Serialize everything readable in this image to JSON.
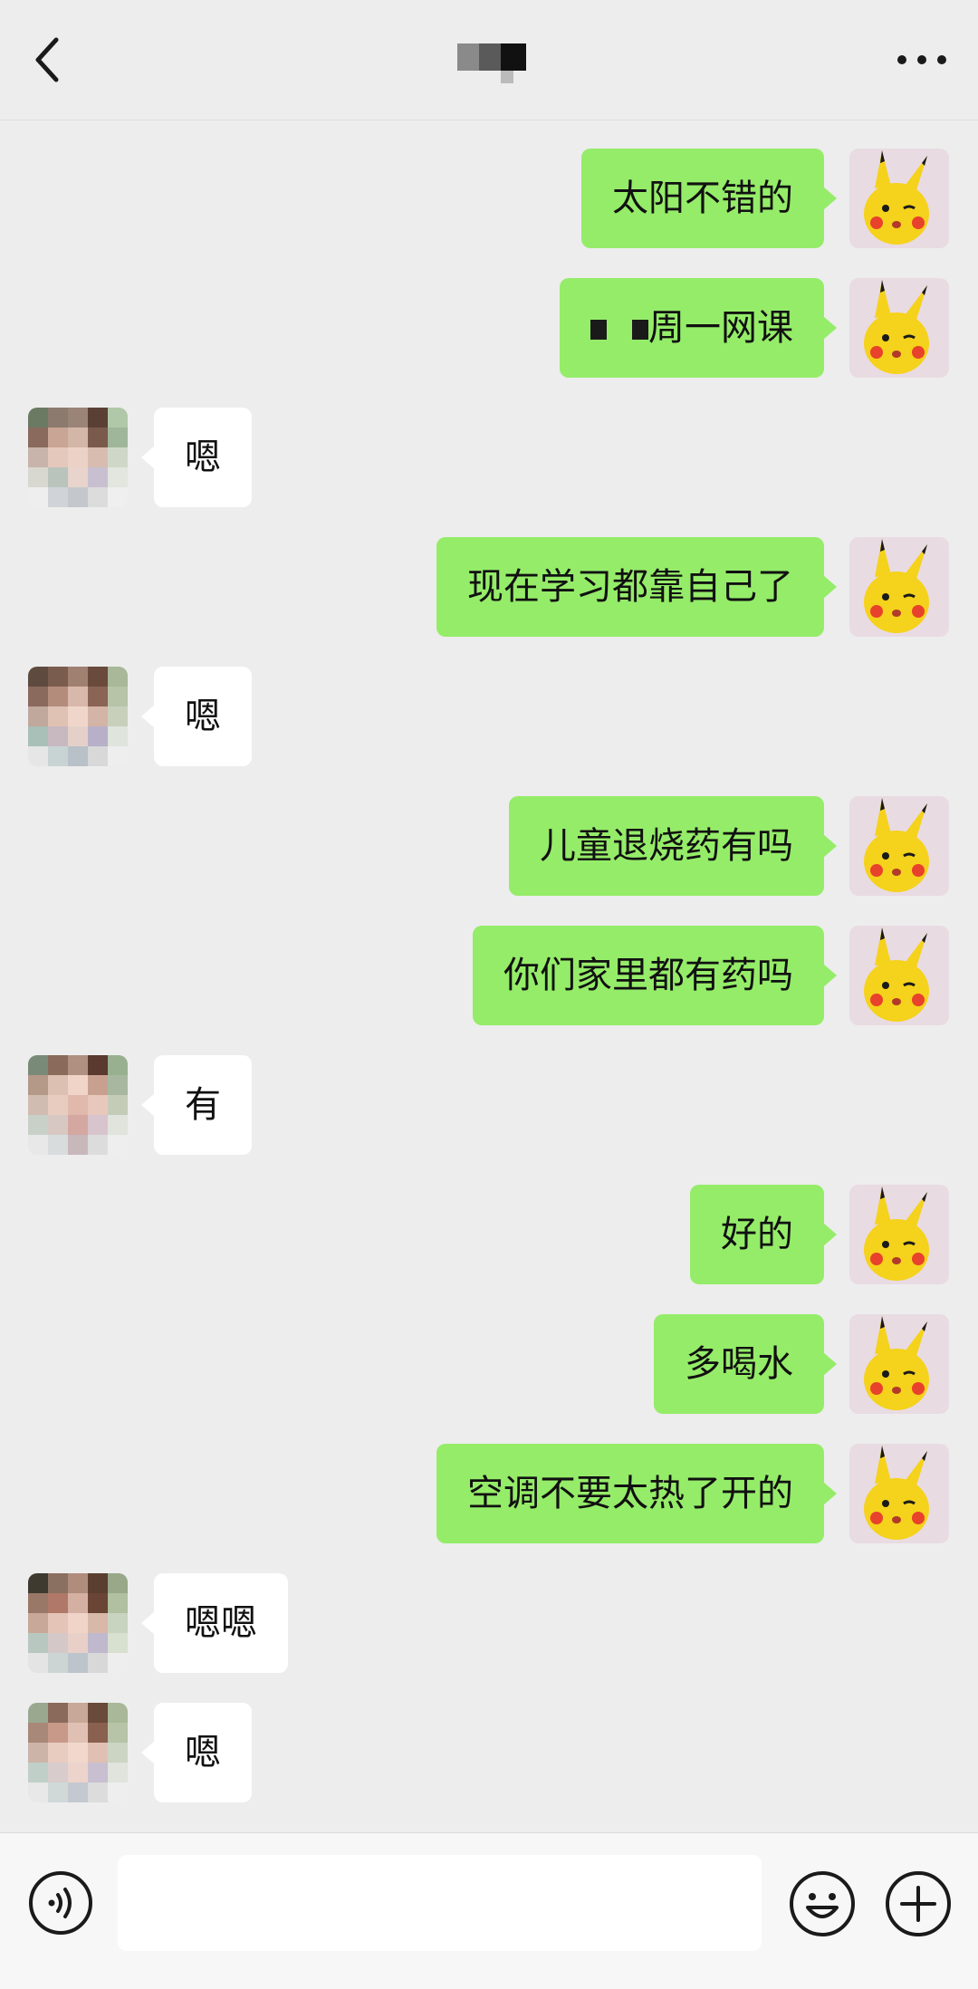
{
  "header": {
    "title": "",
    "back_icon": "chevron-left-icon",
    "more_icon": "more-horizontal-icon"
  },
  "colors": {
    "background": "#ededed",
    "sent_bubble": "#95ec69",
    "received_bubble": "#ffffff",
    "avatar_sent": "#f5d21b",
    "avatar_received": "#c9b3ad"
  },
  "messages": [
    {
      "side": "sent",
      "text": "太阳不错的"
    },
    {
      "side": "sent",
      "text": "周一网课",
      "redacted_prefix": true
    },
    {
      "side": "received",
      "text": "嗯"
    },
    {
      "side": "sent",
      "text": "现在学习都靠自己了"
    },
    {
      "side": "received",
      "text": "嗯"
    },
    {
      "side": "sent",
      "text": "儿童退烧药有吗"
    },
    {
      "side": "sent",
      "text": "你们家里都有药吗"
    },
    {
      "side": "received",
      "text": "有"
    },
    {
      "side": "sent",
      "text": "好的"
    },
    {
      "side": "sent",
      "text": "多喝水"
    },
    {
      "side": "sent",
      "text": "空调不要太热了开的"
    },
    {
      "side": "received",
      "text": "嗯嗯"
    },
    {
      "side": "received",
      "text": "嗯"
    }
  ],
  "input_bar": {
    "value": "",
    "voice_icon": "voice-icon",
    "emoji_icon": "emoji-icon",
    "plus_icon": "plus-circle-icon"
  }
}
